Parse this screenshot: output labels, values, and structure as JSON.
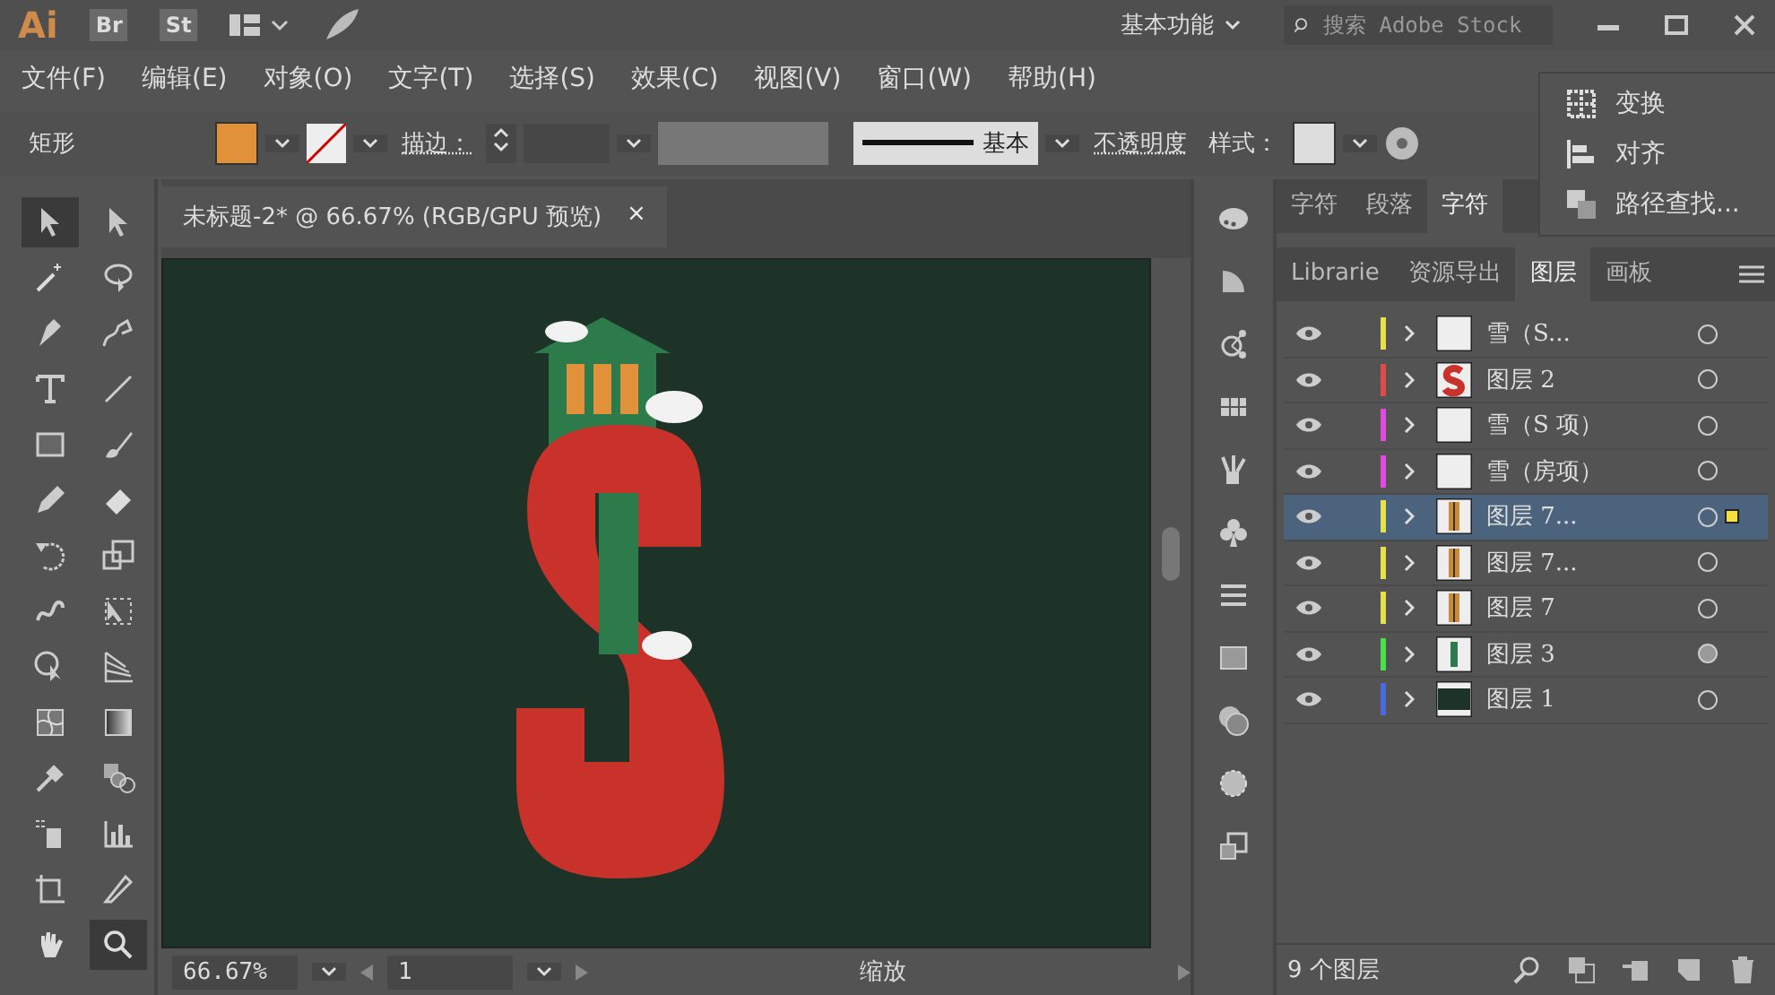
{
  "app": {
    "logo": "Ai",
    "bridge": "Br",
    "stock": "St"
  },
  "workspace": "基本功能",
  "search": {
    "placeholder": "搜索 Adobe Stock"
  },
  "menu": [
    "文件(F)",
    "编辑(E)",
    "对象(O)",
    "文字(T)",
    "选择(S)",
    "效果(C)",
    "视图(V)",
    "窗口(W)",
    "帮助(H)"
  ],
  "control_bar": {
    "object": "矩形",
    "stroke_label": "描边：",
    "stroke_style": "基本",
    "opacity_label": "不透明度",
    "style_label": "样式："
  },
  "document_tab": {
    "title": "未标题-2* @ 66.67% (RGB/GPU 预览)",
    "close": "×"
  },
  "floating_panel": {
    "items": [
      "变换",
      "对齐",
      "路径查找..."
    ]
  },
  "character_tabs": [
    {
      "label": "字符",
      "selected": false
    },
    {
      "label": "段落",
      "selected": false
    },
    {
      "label": "字符",
      "selected": true
    }
  ],
  "layer_tabs": [
    {
      "label": "Librarie",
      "selected": false
    },
    {
      "label": "资源导出",
      "selected": false
    },
    {
      "label": "图层",
      "selected": true
    },
    {
      "label": "画板",
      "selected": false
    }
  ],
  "tools": [
    {
      "selected": true
    },
    {
      "selected": false
    },
    {
      "selected": false
    },
    {
      "selected": false
    },
    {
      "selected": false
    },
    {
      "selected": false
    },
    {
      "selected": false
    },
    {
      "selected": false
    },
    {
      "selected": false
    },
    {
      "selected": false
    },
    {
      "selected": false
    },
    {
      "selected": false
    },
    {
      "selected": false
    },
    {
      "selected": false
    },
    {
      "selected": false
    },
    {
      "selected": false
    },
    {
      "selected": false
    },
    {
      "selected": false
    },
    {
      "selected": false
    },
    {
      "selected": false
    },
    {
      "selected": false
    },
    {
      "selected": false
    },
    {
      "selected": false
    },
    {
      "selected": false
    },
    {
      "selected": false
    },
    {
      "selected": false
    },
    {
      "selected": false
    },
    {
      "selected": true
    }
  ],
  "layers": [
    {
      "name": "雪（S...",
      "color": "#e6e04a",
      "kind": "blank",
      "selected": false,
      "targeted": false
    },
    {
      "name": "图层 2",
      "color": "#e04a4a",
      "kind": "letter",
      "selected": false,
      "targeted": false
    },
    {
      "name": "雪（S 项）",
      "color": "#e04ae0",
      "kind": "blank",
      "selected": false,
      "targeted": false
    },
    {
      "name": "雪（房项）",
      "color": "#e04ae0",
      "kind": "blank",
      "selected": false,
      "targeted": false
    },
    {
      "name": "图层 7...",
      "color": "#e6e04a",
      "kind": "door",
      "selected": true,
      "targeted": false
    },
    {
      "name": "图层 7...",
      "color": "#e6e04a",
      "kind": "door",
      "selected": false,
      "targeted": false
    },
    {
      "name": "图层 7",
      "color": "#e6e04a",
      "kind": "door",
      "selected": false,
      "targeted": false
    },
    {
      "name": "图层 3",
      "color": "#4ae04a",
      "kind": "stripe",
      "selected": false,
      "targeted": true
    },
    {
      "name": "图层 1",
      "color": "#4a6ae0",
      "kind": "dark",
      "selected": false,
      "targeted": false
    }
  ],
  "layer_count": "9 个图层",
  "status_bar": {
    "zoom": "66.67%",
    "artboard": "1",
    "tool": "缩放"
  }
}
